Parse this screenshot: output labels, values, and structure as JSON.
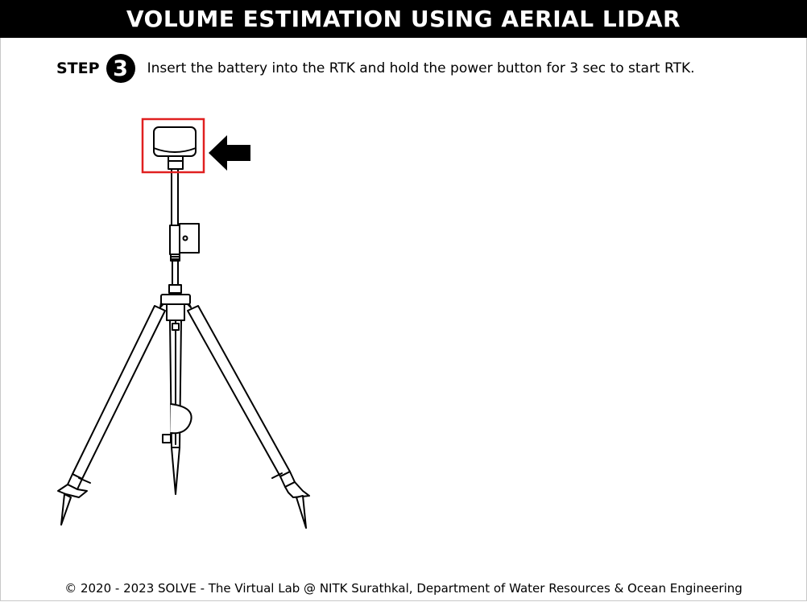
{
  "header": {
    "title": "VOLUME ESTIMATION USING AERIAL LIDAR"
  },
  "step": {
    "label": "STEP",
    "number": "3",
    "instruction": "Insert the battery into the RTK and hold the power button for 3 sec to start RTK."
  },
  "illustration": {
    "highlight_color": "#e02020",
    "arrow_icon": "arrow-left-icon",
    "subject": "rtk-tripod"
  },
  "footer": {
    "text": "© 2020 - 2023 SOLVE - The Virtual Lab @ NITK Surathkal, Department of Water Resources & Ocean Engineering"
  }
}
